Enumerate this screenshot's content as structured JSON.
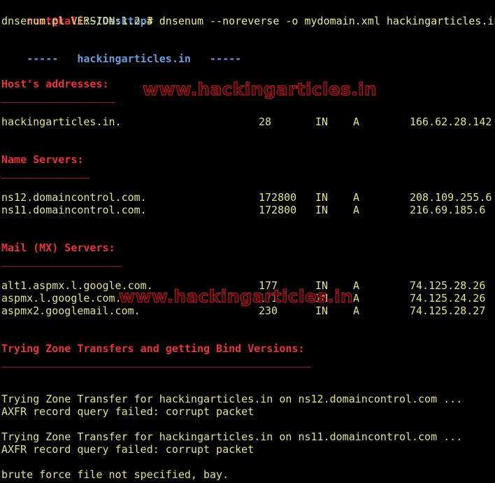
{
  "prompt": {
    "user_host": "root@kali",
    "separator": ":",
    "path": "~/Desktop",
    "symbol": "#",
    "command": " dnsenum --noreverse -o mydomain.xml hackingarticles.in"
  },
  "version_line": "dnsenum.pl VERSION:1.2.3",
  "domain_header": {
    "left_dashes": "-----   ",
    "domain": "hackingarticles.in",
    "right_dashes": "   -----"
  },
  "sections": {
    "host": {
      "title": "Host's addresses:",
      "underline": "__________________",
      "records": [
        {
          "host": "hackingarticles.in.",
          "ttl": "28",
          "class": "IN",
          "type": "A",
          "ip": "166.62.28.142"
        }
      ]
    },
    "ns": {
      "title": "Name Servers:",
      "underline": "______________",
      "records": [
        {
          "host": "ns12.domaincontrol.com.",
          "ttl": "172800",
          "class": "IN",
          "type": "A",
          "ip": "208.109.255.6"
        },
        {
          "host": "ns11.domaincontrol.com.",
          "ttl": "172800",
          "class": "IN",
          "type": "A",
          "ip": "216.69.185.6"
        }
      ]
    },
    "mx": {
      "title": "Mail (MX) Servers:",
      "underline": "___________________",
      "records": [
        {
          "host": "alt1.aspmx.l.google.com.",
          "ttl": "177",
          "class": "IN",
          "type": "A",
          "ip": "74.125.28.26"
        },
        {
          "host": "aspmx.l.google.com.",
          "ttl": "171",
          "class": "IN",
          "type": "A",
          "ip": "74.125.24.26"
        },
        {
          "host": "aspmx2.googlemail.com.",
          "ttl": "230",
          "class": "IN",
          "type": "A",
          "ip": "74.125.28.27"
        }
      ]
    },
    "zone": {
      "title": "Trying Zone Transfers and getting Bind Versions:",
      "underline": "_________________________________________________"
    }
  },
  "zone_attempts": [
    {
      "trying": "Trying Zone Transfer for hackingarticles.in on ns12.domaincontrol.com ...",
      "result": "AXFR record query failed: corrupt packet"
    },
    {
      "trying": "Trying Zone Transfer for hackingarticles.in on ns11.domaincontrol.com ...",
      "result": "AXFR record query failed: corrupt packet"
    }
  ],
  "final_line": "brute force file not specified, bay.",
  "watermarks": [
    "www.hackingarticles.in",
    "www.hackingarticles.in"
  ],
  "colors": {
    "background": "#000000",
    "text": "#e2e28a",
    "accent_red": "#e8343c",
    "path_blue": "#6e9ad6"
  }
}
